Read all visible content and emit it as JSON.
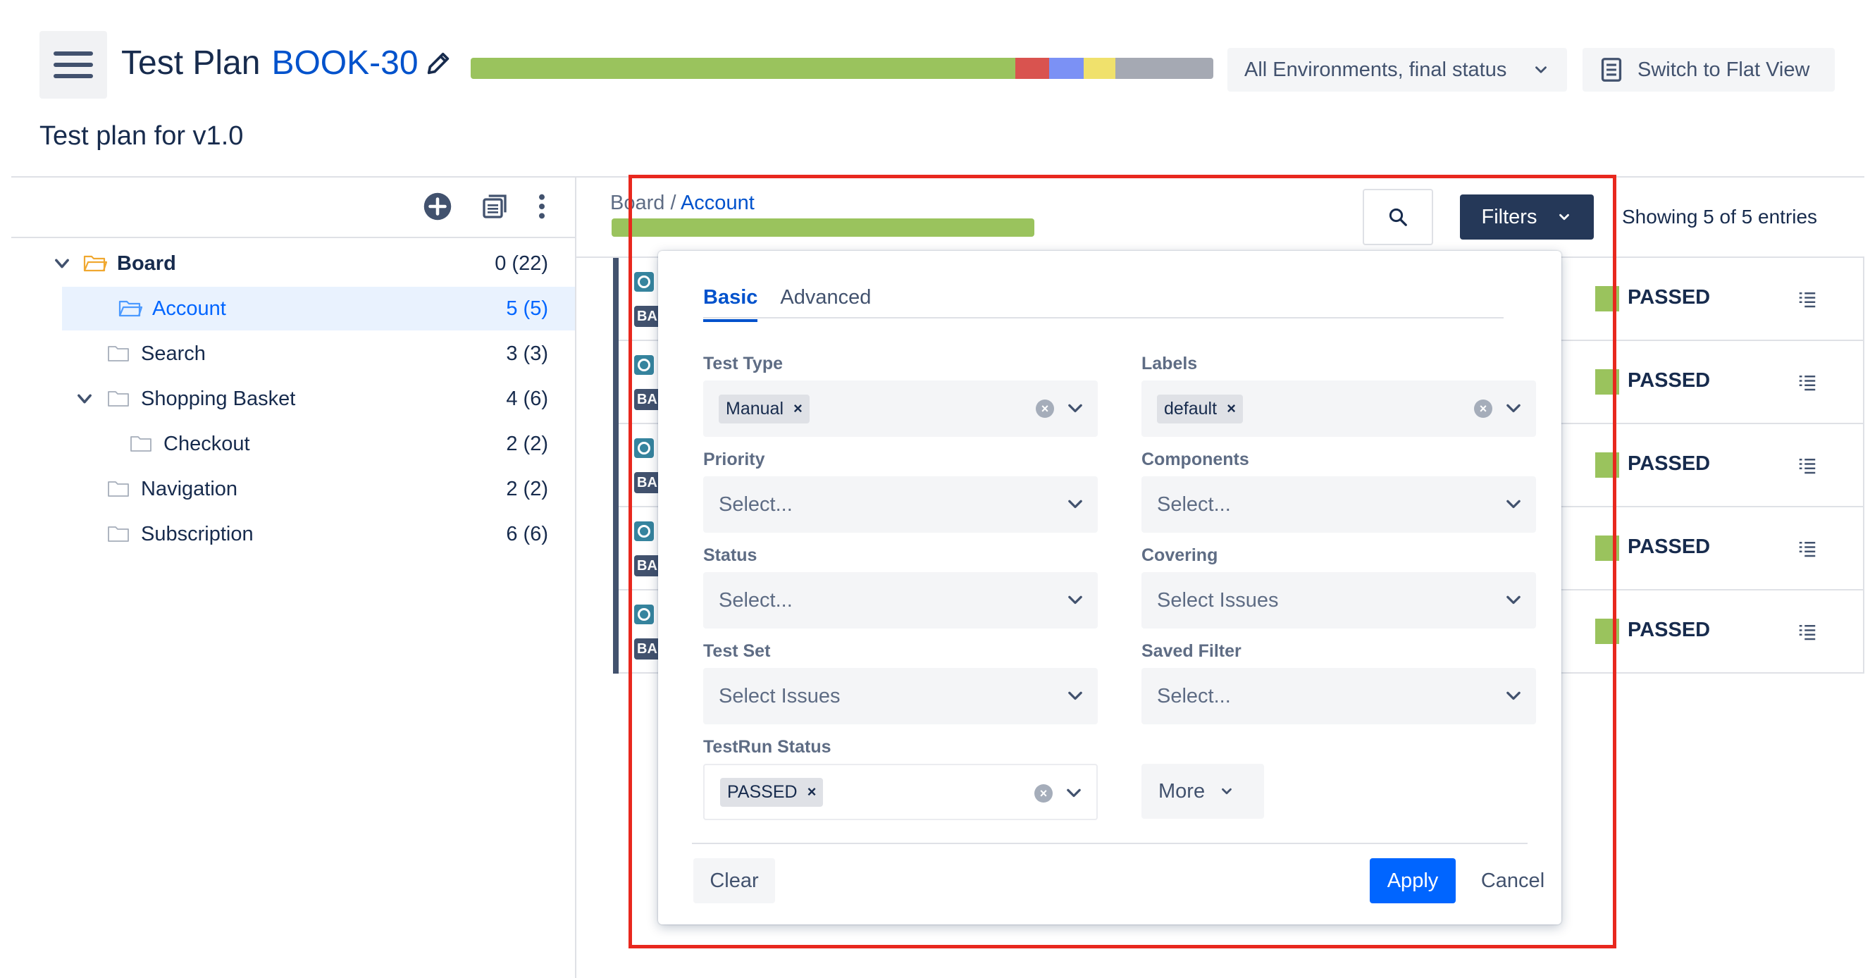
{
  "header": {
    "title": "Test Plan",
    "key": "BOOK-30",
    "subtitle": "Test plan for v1.0",
    "environment_select": "All Environments, final status",
    "flat_view_button": "Switch to Flat View",
    "progress": [
      {
        "status": "passed",
        "fraction": 0.733,
        "color": "#9ac35d"
      },
      {
        "status": "failed",
        "fraction": 0.046,
        "color": "#d9534f"
      },
      {
        "status": "executing",
        "fraction": 0.046,
        "color": "#7b91f5"
      },
      {
        "status": "todo",
        "fraction": 0.043,
        "color": "#f0e16c"
      },
      {
        "status": "other",
        "fraction": 0.132,
        "color": "#a5a9b3"
      }
    ]
  },
  "tree": {
    "items": [
      {
        "label": "Board",
        "count": "0 (22)"
      },
      {
        "label": "Account",
        "count": "5 (5)"
      },
      {
        "label": "Search",
        "count": "3 (3)"
      },
      {
        "label": "Shopping Basket",
        "count": "4 (6)"
      },
      {
        "label": "Checkout",
        "count": "2 (2)"
      },
      {
        "label": "Navigation",
        "count": "2 (2)"
      },
      {
        "label": "Subscription",
        "count": "6 (6)"
      }
    ]
  },
  "main": {
    "breadcrumb_root": "Board",
    "breadcrumb_sep": " / ",
    "breadcrumb_current": "Account",
    "filters_button": "Filters",
    "showing": "Showing 5 of 5 entries",
    "rows": [
      {
        "type_abbr": "BA",
        "status": "PASSED"
      },
      {
        "type_abbr": "BA",
        "status": "PASSED"
      },
      {
        "type_abbr": "BA",
        "status": "PASSED"
      },
      {
        "type_abbr": "BA",
        "status": "PASSED"
      },
      {
        "type_abbr": "BA",
        "status": "PASSED"
      }
    ]
  },
  "filters": {
    "tabs": [
      "Basic",
      "Advanced"
    ],
    "test_type": {
      "label": "Test Type",
      "chip": "Manual"
    },
    "labels": {
      "label": "Labels",
      "chip": "default"
    },
    "priority": {
      "label": "Priority",
      "placeholder": "Select..."
    },
    "components": {
      "label": "Components",
      "placeholder": "Select..."
    },
    "status": {
      "label": "Status",
      "placeholder": "Select..."
    },
    "covering": {
      "label": "Covering",
      "placeholder": "Select Issues"
    },
    "test_set": {
      "label": "Test Set",
      "placeholder": "Select Issues"
    },
    "saved_filter": {
      "label": "Saved Filter",
      "placeholder": "Select..."
    },
    "testrun_status": {
      "label": "TestRun Status",
      "chip": "PASSED"
    },
    "more_button": "More",
    "clear_button": "Clear",
    "apply_button": "Apply",
    "cancel_button": "Cancel",
    "chip_remove": "×",
    "clear_glyph": "×"
  }
}
